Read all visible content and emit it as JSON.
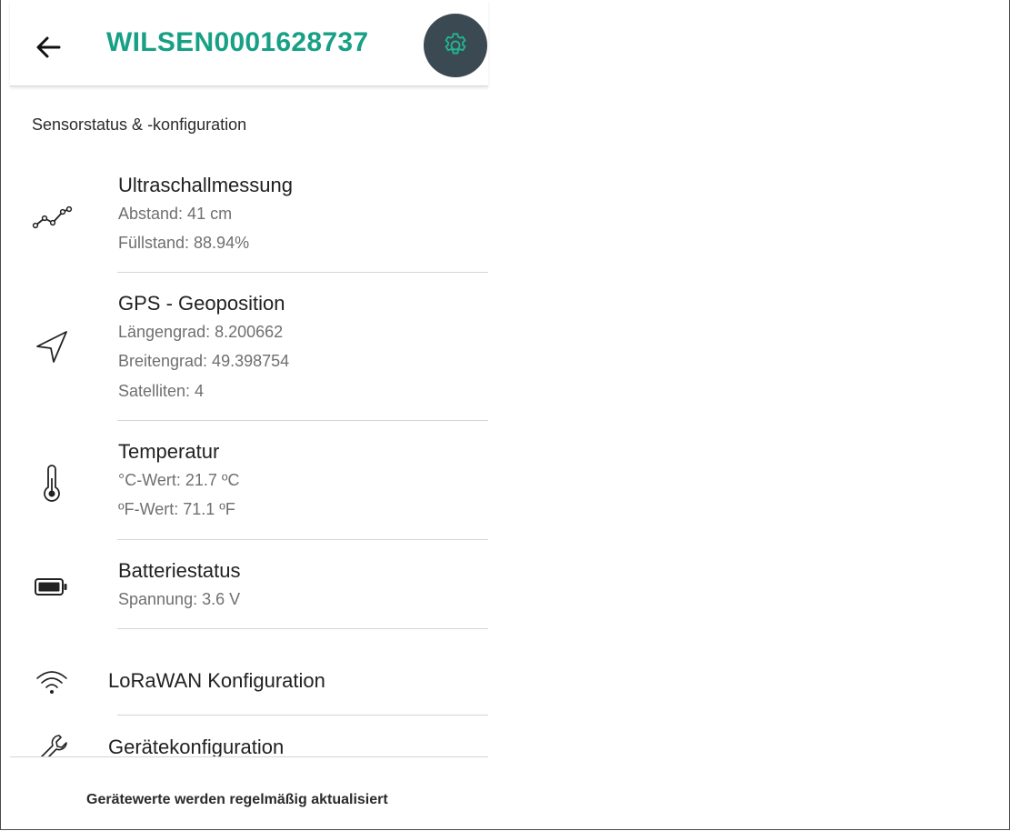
{
  "header": {
    "back_icon": "arrow-left-icon",
    "title": "WILSEN0001628737",
    "settings_icon": "gear-icon",
    "accent_color": "#17a085",
    "settings_bg": "#3b4953"
  },
  "section": {
    "title": "Sensorstatus & -konfiguration"
  },
  "sensors": [
    {
      "icon": "chart-line-icon",
      "name": "Ultraschallmessung",
      "lines": [
        "Abstand: 41 cm",
        "Füllstand: 88.94%"
      ]
    },
    {
      "icon": "navigation-arrow-icon",
      "name": "GPS - Geoposition",
      "lines": [
        "Längengrad: 8.200662",
        "Breitengrad: 49.398754",
        "Satelliten: 4"
      ]
    },
    {
      "icon": "thermometer-icon",
      "name": "Temperatur",
      "lines": [
        "°C-Wert: 21.7 ºC",
        "ºF-Wert: 71.1 ºF"
      ]
    },
    {
      "icon": "battery-icon",
      "name": "Batteriestatus",
      "lines": [
        "Spannung: 3.6 V"
      ]
    }
  ],
  "menu": [
    {
      "icon": "wifi-icon",
      "label": "LoRaWAN Konfiguration"
    },
    {
      "icon": "wrench-icon",
      "label": "Gerätekonfiguration"
    }
  ],
  "footer": {
    "text": "Gerätewerte werden regelmäßig aktualisiert"
  }
}
